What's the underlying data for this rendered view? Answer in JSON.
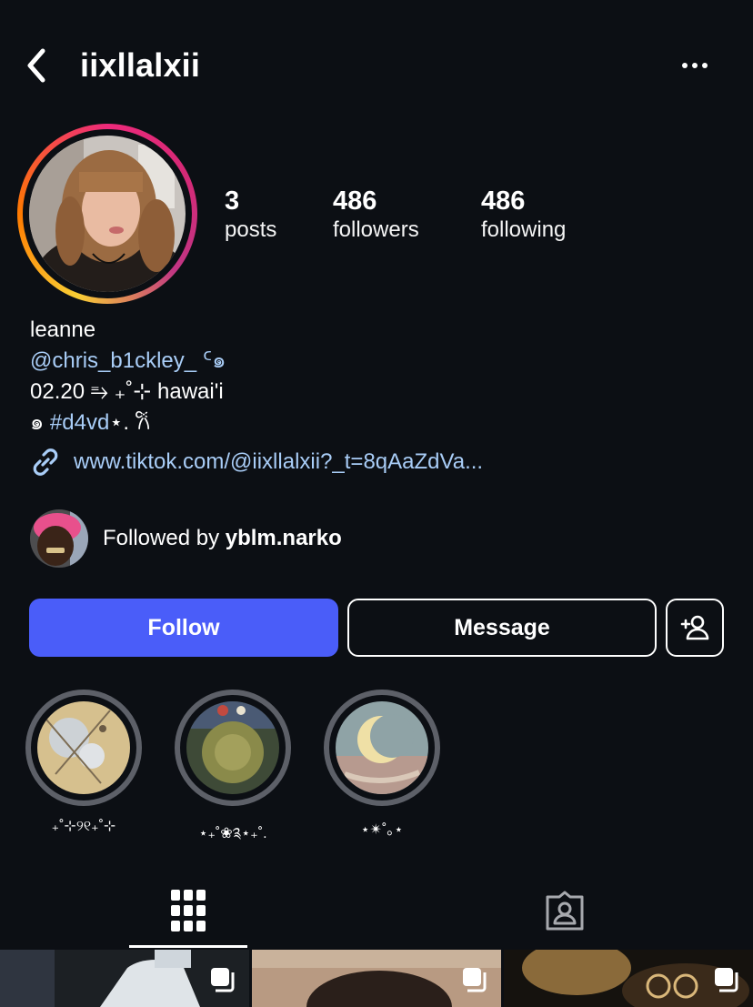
{
  "header": {
    "username": "iixllalxii",
    "back_icon": "chevron-left-icon",
    "more_icon": "more-horizontal-icon"
  },
  "stats": {
    "posts": {
      "count": "3",
      "label": "posts"
    },
    "followers": {
      "count": "486",
      "label": "followers"
    },
    "following": {
      "count": "486",
      "label": "following"
    }
  },
  "bio": {
    "name": "leanne",
    "mention": "@chris_b1ckley_",
    "mention_suffix": " ᑦ๑",
    "line3": "02.20 ⥱ ₊˚⊹ hawai'i",
    "line4_prefix": "๑ ",
    "hashtag": "#d4vd",
    "line4_suffix": "⋆. 𐙚",
    "url": "www.tiktok.com/@iixllalxii?_t=8qAaZdVa..."
  },
  "followed_by": {
    "prefix": "Followed by ",
    "user": "yblm.narko"
  },
  "buttons": {
    "follow": "Follow",
    "message": "Message",
    "add_user_icon": "add-user-icon"
  },
  "highlights": [
    {
      "label": "₊˚⊹୨୧₊˚⊹"
    },
    {
      "label": "⋆₊˚❀༉⋆₊˚."
    },
    {
      "label": "⋆✴︎˚｡⋆"
    }
  ],
  "tabs": {
    "posts_icon": "grid-icon",
    "tagged_icon": "tagged-person-icon"
  },
  "colors": {
    "background": "#0c0f14",
    "follow_button": "#4a5df9",
    "link": "#a9cdf7",
    "highlight_ring": "#5d6068"
  }
}
